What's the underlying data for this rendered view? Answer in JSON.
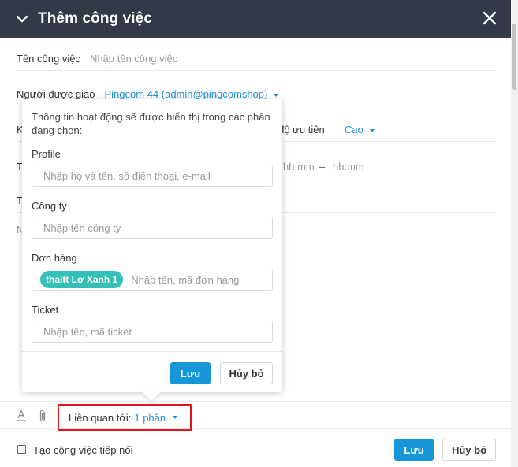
{
  "dialog": {
    "title": "Thêm công việc",
    "collapse_icon": "chevron-down-icon",
    "close_icon": "close-icon"
  },
  "form": {
    "task_name": {
      "label": "Tên công việc",
      "placeholder": "Nhập tên công việc"
    },
    "assignee": {
      "label": "Người được giao",
      "value": "Pingcom 44 (admin@pingcomshop)"
    },
    "priority": {
      "label_fragment": "c độ ưu tiên",
      "value": "Cao"
    },
    "time": {
      "start_placeholder": "hh:mm",
      "separator": "–",
      "end_placeholder": "hh:mm"
    },
    "hidden_labels": [
      "K",
      "T",
      "T",
      "N"
    ]
  },
  "related_popover": {
    "info": "Thông tin hoạt động sẽ được hiển thị trong các phần đang chọn:",
    "profile": {
      "label": "Profile",
      "placeholder": "Nhập họ và tên, số điện thoại, e-mail"
    },
    "company": {
      "label": "Công ty",
      "placeholder": "Nhập tên công ty"
    },
    "order": {
      "label": "Đơn hàng",
      "tag": "thaitt Lơ Xanh 1",
      "placeholder": "Nhập tên, mã đơn hàng"
    },
    "ticket": {
      "label": "Ticket",
      "placeholder": "Nhập tên, mã ticket"
    },
    "save_label": "Lưu",
    "cancel_label": "Hủy bỏ"
  },
  "toolbar": {
    "text_format_icon": "text-color-icon",
    "attach_icon": "paperclip-icon",
    "related_label": "Liên quan tới:",
    "related_value": "1 phần"
  },
  "footer": {
    "followup_label": "Tạo công việc tiếp nối",
    "save_label": "Lưu",
    "cancel_label": "Hủy bỏ"
  },
  "colors": {
    "header_bg": "#323a47",
    "accent": "#1696d8",
    "link": "#1e8fd6",
    "tag": "#35bfb9",
    "highlight_border": "#e3151f"
  }
}
